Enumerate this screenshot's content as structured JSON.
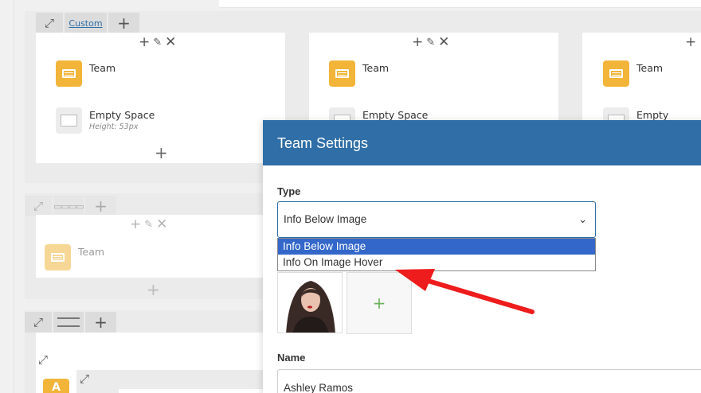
{
  "builder": {
    "row1": {
      "toolbar": {
        "expand_icon": "expand-icon",
        "layout_label": "Custom",
        "add_label": "+"
      },
      "columns": [
        {
          "element1": "Team",
          "element2": "Empty Space",
          "element2_sub": "Height: 53px"
        },
        {
          "element1": "Team",
          "element2": "Empty Space"
        },
        {
          "element1": "Team",
          "element2": "Empty Space"
        }
      ]
    },
    "row2": {
      "element1": "Team"
    },
    "row3": {
      "element_letter": "A"
    }
  },
  "modal": {
    "title": "Team Settings",
    "type_label": "Type",
    "type_value": "Info Below Image",
    "type_options": [
      "Info Below Image",
      "Info On Image Hover"
    ],
    "add_image_label": "+",
    "name_label": "Name",
    "name_value": "Ashley Ramos"
  },
  "annotation": {
    "arrow_color": "#ee1c1c"
  },
  "colors": {
    "accent": "#2f6ea6",
    "icon": "#f2b53a",
    "selected_option": "#3367c9"
  }
}
